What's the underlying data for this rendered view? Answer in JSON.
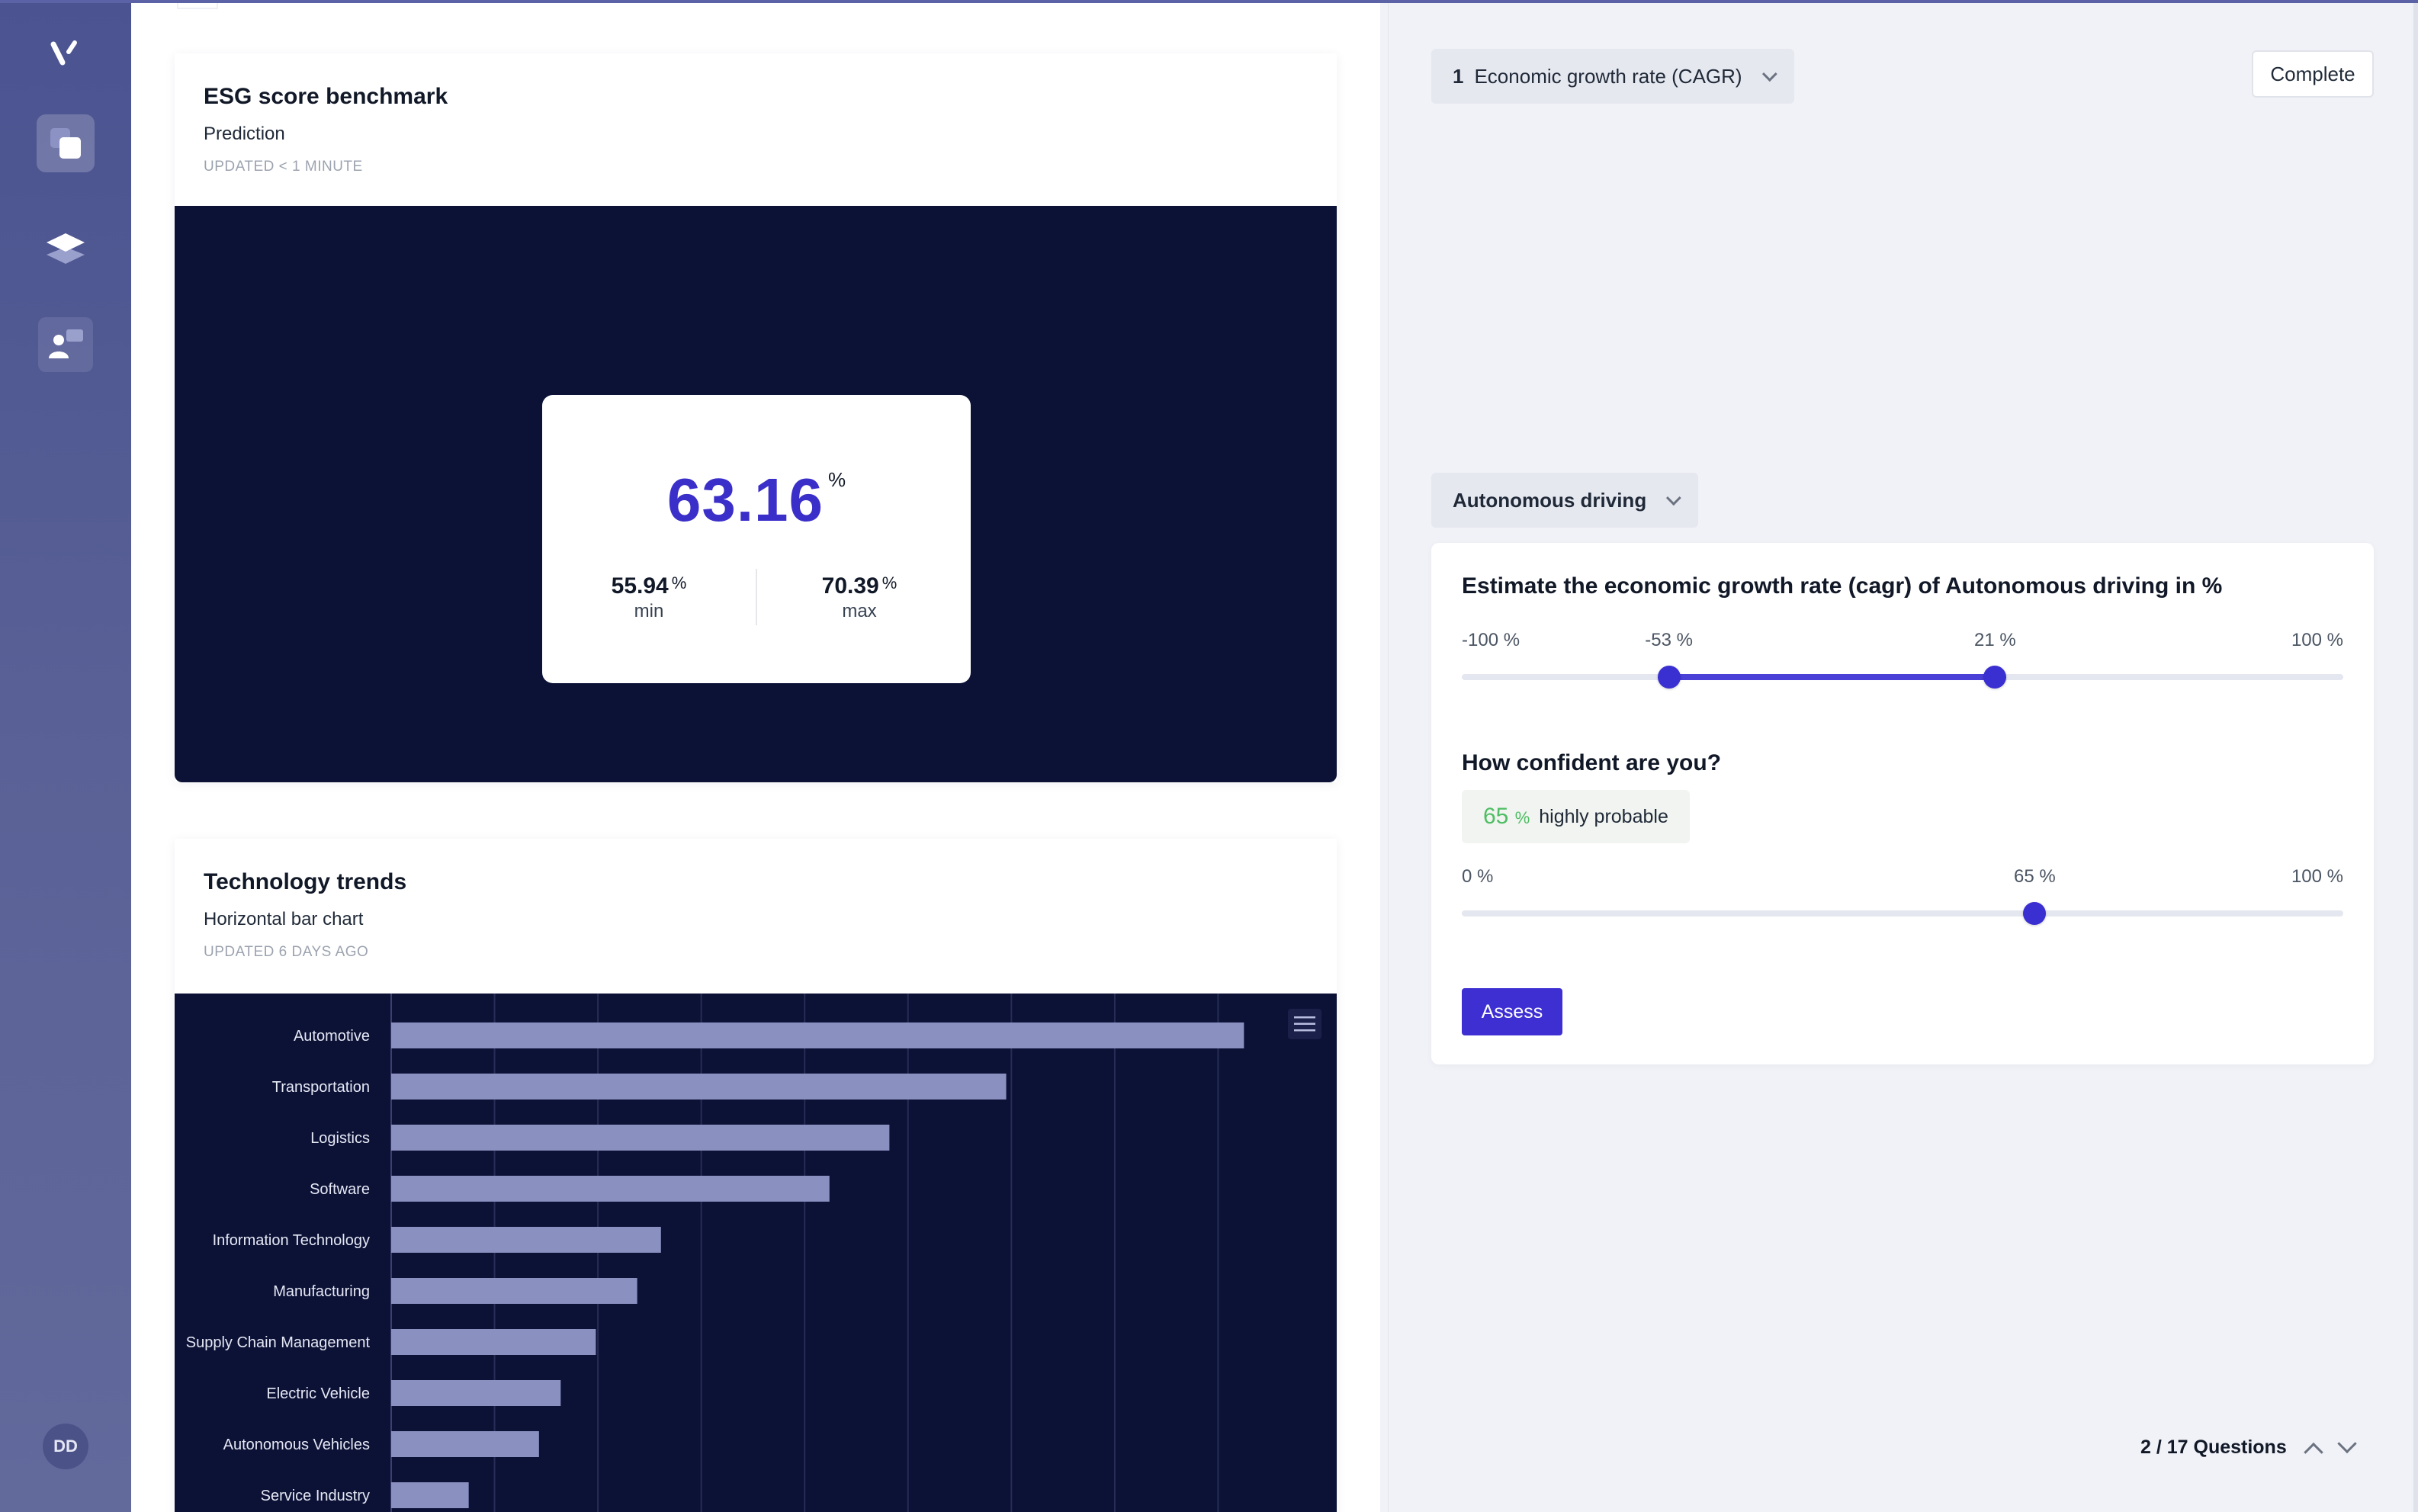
{
  "sidebar": {
    "avatar_initials": "DD"
  },
  "cards": {
    "esg": {
      "title": "ESG score benchmark",
      "subtitle": "Prediction",
      "updated": "UPDATED < 1 MINUTE",
      "value": "63.16",
      "unit": "%",
      "min_value": "55.94",
      "min_unit": "%",
      "min_label": "min",
      "max_value": "70.39",
      "max_unit": "%",
      "max_label": "max"
    },
    "trends": {
      "title": "Technology trends",
      "subtitle": "Horizontal bar chart",
      "updated": "UPDATED 6 DAYS AGO"
    }
  },
  "chart_data": {
    "type": "bar",
    "orientation": "horizontal",
    "categories": [
      "Automotive",
      "Transportation",
      "Logistics",
      "Software",
      "Information Technology",
      "Manufacturing",
      "Supply Chain Management",
      "Electric Vehicle",
      "Autonomous Vehicles",
      "Service Industry"
    ],
    "values": [
      82.5,
      59.5,
      48.2,
      42.4,
      26.1,
      23.8,
      19.8,
      16.4,
      14.3,
      7.5
    ],
    "xlim": [
      0,
      90
    ],
    "grid": true,
    "bar_color": "#8a90c0"
  },
  "right_panel": {
    "metric_dropdown": {
      "number": "1",
      "label": "Economic growth rate (CAGR)"
    },
    "complete_label": "Complete",
    "topic_dropdown": "Autonomous driving",
    "question": "Estimate the economic growth rate (cagr) of Autonomous driving in %",
    "range_slider": {
      "ticks": [
        "-100 %",
        "-53 %",
        "21 %",
        "100 %"
      ],
      "min": -100,
      "max": 100,
      "low": -53,
      "high": 21
    },
    "confidence_title": "How confident are you?",
    "confidence_badge": {
      "value": "65",
      "unit": "%",
      "text": "highly probable"
    },
    "confidence_slider": {
      "ticks": [
        "0 %",
        "65 %",
        "100 %"
      ],
      "min": 0,
      "max": 100,
      "value": 65
    },
    "assess_label": "Assess",
    "pager": "2 / 17 Questions"
  },
  "colors": {
    "accent": "#3d2fd2",
    "dark_panel": "#0c1236",
    "confidence_green": "#4ebd63"
  }
}
